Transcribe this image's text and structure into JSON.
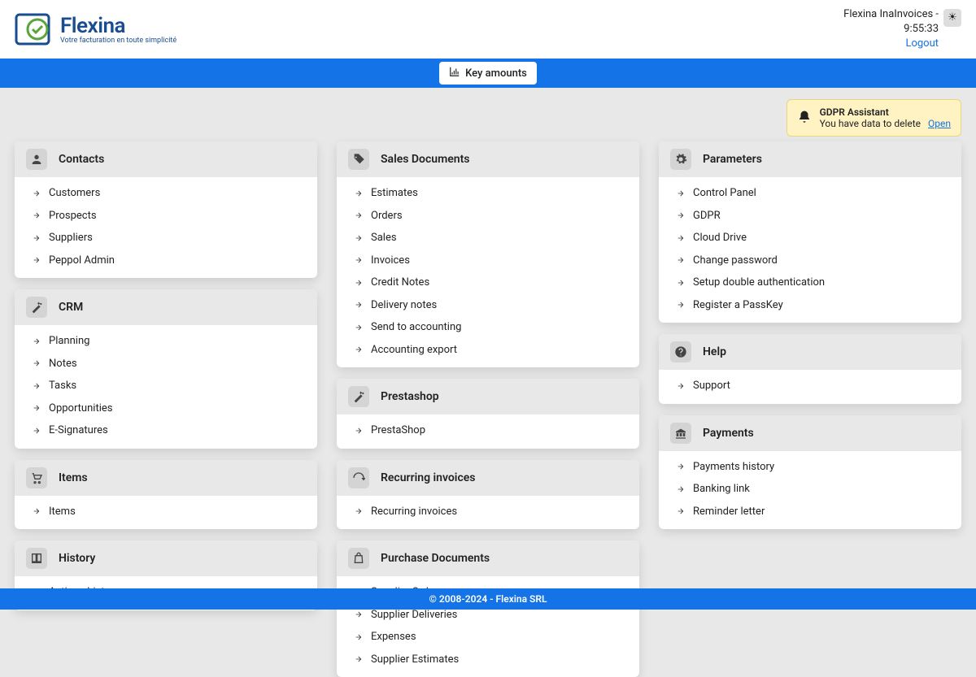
{
  "brand": {
    "name": "Flexina",
    "tagline": "Votre facturation en toute simplicité"
  },
  "header": {
    "user": "Flexina InaInvoices -",
    "time": "9:55:33",
    "logout": "Logout"
  },
  "bluebar": {
    "key_amounts": "Key amounts"
  },
  "gdpr": {
    "title": "GDPR Assistant",
    "msg": "You have data to delete",
    "open": "Open"
  },
  "columns": [
    [
      {
        "icon": "people",
        "title": "Contacts",
        "items": [
          "Customers",
          "Prospects",
          "Suppliers",
          "Peppol Admin"
        ]
      },
      {
        "icon": "wand",
        "title": "CRM",
        "items": [
          "Planning",
          "Notes",
          "Tasks",
          "Opportunities",
          "E-Signatures"
        ]
      },
      {
        "icon": "cart",
        "title": "Items",
        "items": [
          "Items"
        ]
      },
      {
        "icon": "book",
        "title": "History",
        "items": [
          "Actions history"
        ]
      }
    ],
    [
      {
        "icon": "tag",
        "title": "Sales Documents",
        "items": [
          "Estimates",
          "Orders",
          "Sales",
          "Invoices",
          "Credit Notes",
          "Delivery notes",
          "Send to accounting",
          "Accounting export"
        ]
      },
      {
        "icon": "wand",
        "title": "Prestashop",
        "items": [
          "PrestaShop"
        ]
      },
      {
        "icon": "recur",
        "title": "Recurring invoices",
        "items": [
          "Recurring invoices"
        ]
      },
      {
        "icon": "bag",
        "title": "Purchase Documents",
        "items": [
          "Supplier Orders",
          "Supplier Deliveries",
          "Expenses",
          "Supplier Estimates"
        ]
      }
    ],
    [
      {
        "icon": "gear",
        "title": "Parameters",
        "items": [
          "Control Panel",
          "GDPR",
          "Cloud Drive",
          "Change password",
          "Setup double authentication",
          "Register a PassKey"
        ]
      },
      {
        "icon": "help",
        "title": "Help",
        "items": [
          "Support"
        ]
      },
      {
        "icon": "bank",
        "title": "Payments",
        "items": [
          "Payments history",
          "Banking link",
          "Reminder letter"
        ]
      }
    ]
  ],
  "footer": "© 2008-2024 - Flexina SRL"
}
